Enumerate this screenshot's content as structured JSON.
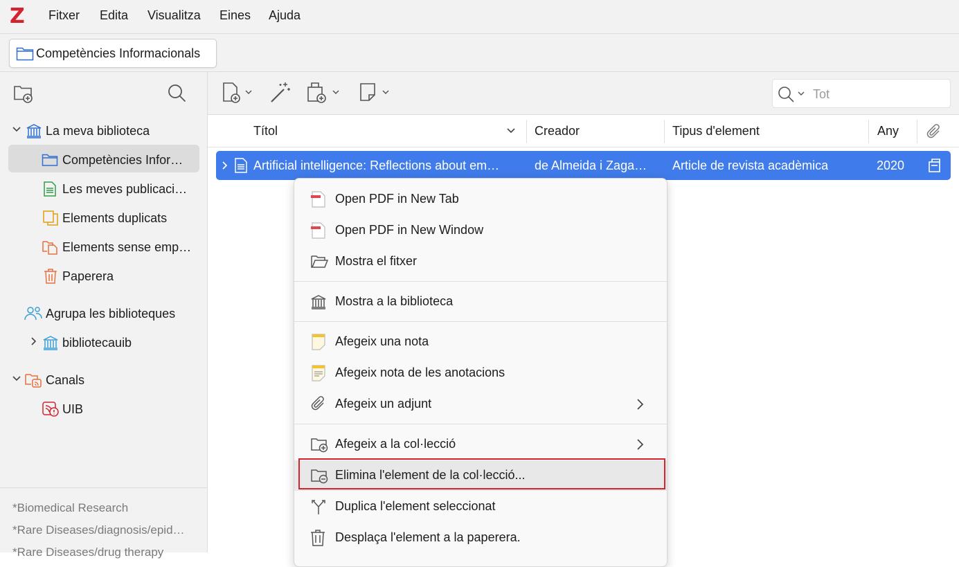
{
  "menubar": {
    "logo": "Z",
    "items": [
      "Fitxer",
      "Edita",
      "Visualitza",
      "Eines",
      "Ajuda"
    ]
  },
  "tab": {
    "label": "Competències Informacionals"
  },
  "sidebar": {
    "library": "La meva biblioteca",
    "items": [
      "Competències Infor…",
      "Les meves publicaci…",
      "Elements duplicats",
      "Elements sense emp…",
      "Paperera"
    ],
    "groups_header": "Agrupa les biblioteques",
    "group": "bibliotecauib",
    "feeds_header": "Canals",
    "feed": "UIB",
    "tags": [
      "*Biomedical Research",
      "*Rare Diseases/diagnosis/epid…",
      "*Rare Diseases/drug therapy"
    ]
  },
  "search": {
    "mode": "Tot"
  },
  "columns": {
    "title": "Títol",
    "creator": "Creador",
    "item_type": "Tipus d'element",
    "year": "Any"
  },
  "selected_row": {
    "title": "Artificial intelligence: Reflections about em…",
    "creator": "de Almeida i Zaga…",
    "item_type": "Article de revista acadèmica",
    "year": "2020"
  },
  "context_menu": {
    "items": [
      "Open PDF in New Tab",
      "Open PDF in New Window",
      "Mostra el fitxer",
      "Mostra a la biblioteca",
      "Afegeix una nota",
      "Afegeix nota de les anotacions",
      "Afegeix un adjunt",
      "Afegeix a la col·lecció",
      "Elimina l'element de la col·lecció...",
      "Duplica l'element seleccionat",
      "Desplaça l'element a la paperera."
    ],
    "highlighted": "Elimina l'element de la col·lecció..."
  },
  "colors": {
    "accent": "#3f7bea",
    "brand": "#d4232f",
    "highlight_border": "#d4232f"
  }
}
